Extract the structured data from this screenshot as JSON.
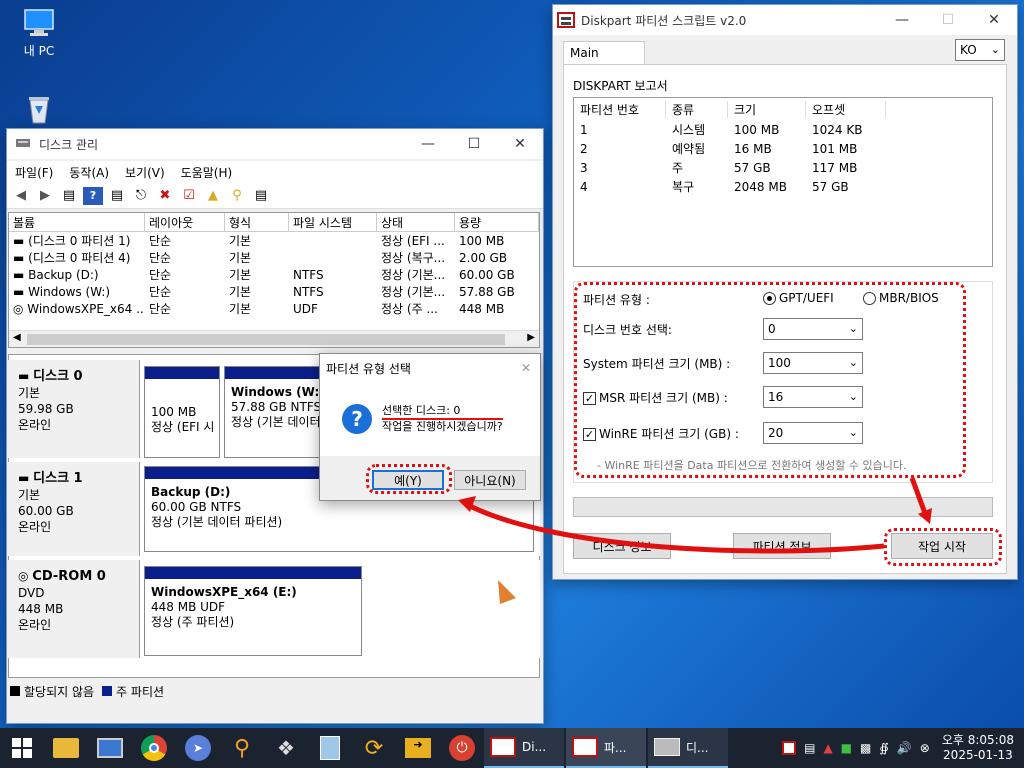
{
  "desktop": {
    "icons": [
      {
        "label": "내 PC"
      },
      {
        "label": ""
      }
    ]
  },
  "disk_mgmt": {
    "title": "디스크 관리",
    "menu": [
      "파일(F)",
      "동작(A)",
      "보기(V)",
      "도움말(H)"
    ],
    "columns": [
      "볼륨",
      "레이아웃",
      "형식",
      "파일 시스템",
      "상태",
      "용량"
    ],
    "rows": [
      {
        "volume": "(디스크 0 파티션 1)",
        "layout": "단순",
        "type": "기본",
        "fs": "",
        "status": "정상 (EFI ...",
        "size": "100 MB"
      },
      {
        "volume": "(디스크 0 파티션 4)",
        "layout": "단순",
        "type": "기본",
        "fs": "",
        "status": "정상 (복구...",
        "size": "2.00 GB"
      },
      {
        "volume": "Backup (D:)",
        "layout": "단순",
        "type": "기본",
        "fs": "NTFS",
        "status": "정상 (기본...",
        "size": "60.00 GB"
      },
      {
        "volume": "Windows (W:)",
        "layout": "단순",
        "type": "기본",
        "fs": "NTFS",
        "status": "정상 (기본...",
        "size": "57.88 GB"
      },
      {
        "volume": "WindowsXPE_x64 ...",
        "layout": "단순",
        "type": "기본",
        "fs": "UDF",
        "status": "정상 (주 ...",
        "size": "448 MB"
      }
    ],
    "disks": [
      {
        "name": "디스크 0",
        "kind": "기본",
        "size": "59.98 GB",
        "state": "온라인"
      },
      {
        "name": "디스크 1",
        "kind": "기본",
        "size": "60.00 GB",
        "state": "온라인"
      },
      {
        "name": "CD-ROM 0",
        "kind": "DVD",
        "size": "448 MB",
        "state": "온라인"
      }
    ],
    "parts": {
      "d0p1": {
        "size": "100 MB",
        "status": "정상 (EFI 시"
      },
      "d0p2": {
        "name": "Windows   (W:)",
        "size": "57.88 GB NTFS",
        "status": "정상 (기본 데이터"
      },
      "d1p1": {
        "name": "Backup   (D:)",
        "size": "60.00 GB NTFS",
        "status": "정상 (기본 데이터 파티션)"
      },
      "cd": {
        "name": "WindowsXPE_x64   (E:)",
        "size": "448 MB UDF",
        "status": "정상 (주 파티션)"
      }
    },
    "legend": [
      "할당되지 않음",
      "주 파티션"
    ]
  },
  "dialog": {
    "title": "파티션 유형 선택",
    "line1": "선택한 디스크: 0",
    "line2": "작업을 진행하시겠습니까?",
    "yes": "예(Y)",
    "no": "아니요(N)"
  },
  "diskpart": {
    "title": "Diskpart 파티션 스크립트 v2.0",
    "tab": "Main",
    "lang": "KO",
    "report_label": "DISKPART 보고서",
    "columns": [
      "파티션 번호",
      "종류",
      "크기",
      "오프셋"
    ],
    "rows": [
      {
        "num": "1",
        "kind": "시스템",
        "size": "100 MB",
        "offset": "1024 KB"
      },
      {
        "num": "2",
        "kind": "예약됨",
        "size": "16 MB",
        "offset": "101 MB"
      },
      {
        "num": "3",
        "kind": "주",
        "size": "57 GB",
        "offset": "117 MB"
      },
      {
        "num": "4",
        "kind": "복구",
        "size": "2048 MB",
        "offset": "57 GB"
      }
    ],
    "ptype_label": "파티션 유형 :",
    "gpt_label": "GPT/UEFI",
    "mbr_label": "MBR/BIOS",
    "disk_sel_label": "디스크 번호 선택:",
    "disk_sel_value": "0",
    "sys_size_label": "System 파티션 크기 (MB) :",
    "sys_size_value": "100",
    "msr_label": "MSR 파티션 크기 (MB) :",
    "msr_value": "16",
    "winre_label": "WinRE 파티션 크기 (GB) :",
    "winre_value": "20",
    "note": "- WinRE 파티션을 Data 파티션으로 전환하여 생성할 수 있습니다.",
    "btn_disk_info": "디스크 정보",
    "btn_part_info": "파티션 정보",
    "btn_start": "작업 시작",
    "progress": 0
  },
  "taskbar": {
    "tasks": [
      {
        "label": "Di..."
      },
      {
        "label": "파..."
      },
      {
        "label": "디..."
      }
    ],
    "time": "오후 8:05:08",
    "date": "2025-01-13"
  }
}
